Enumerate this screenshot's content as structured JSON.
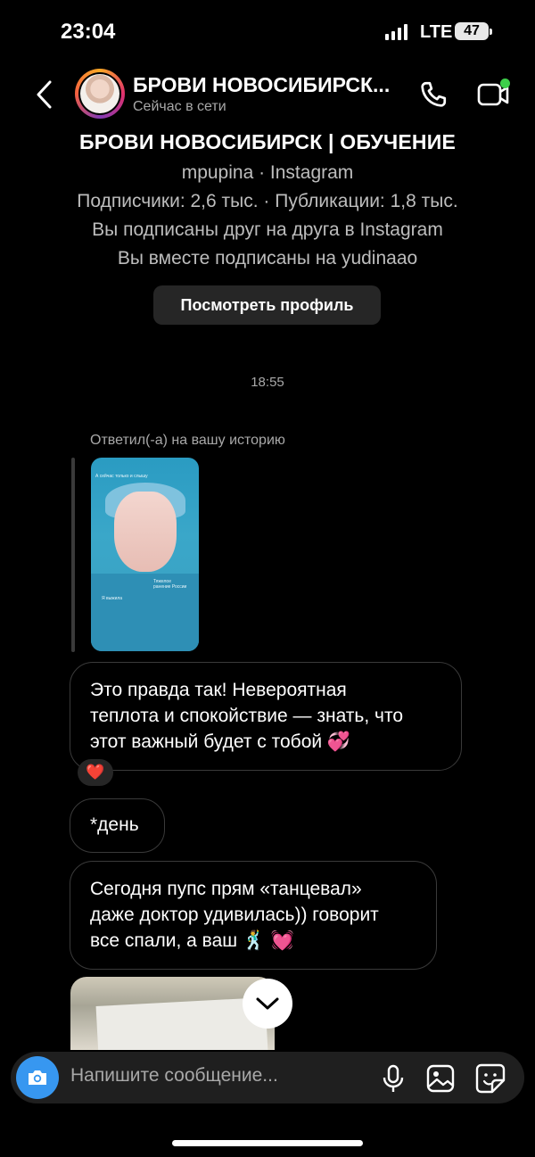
{
  "status_bar": {
    "time": "23:04",
    "network": "LTE",
    "battery": "47"
  },
  "header": {
    "title": "БРОВИ НОВОСИБИРСК...",
    "subtitle": "Сейчас в сети"
  },
  "profile": {
    "name": "БРОВИ НОВОСИБИРСК | ОБУЧЕНИЕ",
    "handle": "mpupina · Instagram",
    "stats": "Подписчики: 2,6 тыс. · Публикации: 1,8 тыс.",
    "mutual": "Вы подписаны друг на друга в Instagram",
    "common": "Вы вместе подписаны на yudinaao",
    "view_button": "Посмотреть профиль"
  },
  "chat": {
    "timestamp": "18:55",
    "reply_label": "Ответил(-а) на вашу историю",
    "story_texts": [
      "А сейчас только и слышу",
      "Тяжелое ранение России",
      "Я выжила"
    ],
    "messages": [
      {
        "lines": [
          "Это правда так! Невероятная",
          "теплота  и спокойствие — знать, что",
          "этот важный будет с тобой 💞"
        ]
      },
      {
        "lines": [
          "*день"
        ]
      },
      {
        "lines": [
          "Сегодня пупс прям «танцевал»",
          "даже доктор удивилась)) говорит",
          "все спали, а ваш 🕺 💓"
        ]
      }
    ],
    "reaction": "❤️"
  },
  "composer": {
    "placeholder": "Напишите сообщение..."
  },
  "colors": {
    "accent": "#3797f0",
    "online": "#3ecf4a",
    "bubble_border": "#3a3a3a",
    "composer_bg": "#1f1f1f"
  }
}
